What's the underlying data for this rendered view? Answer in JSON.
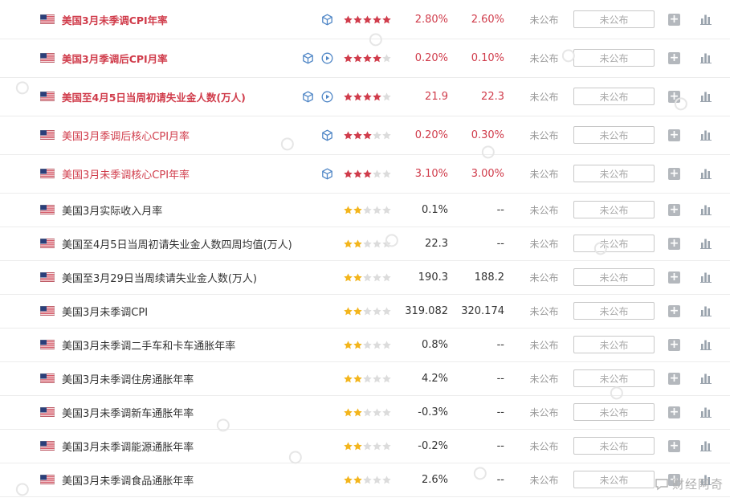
{
  "status_label": "未公布",
  "actual_placeholder": "未公布",
  "add_label": "+",
  "brand": "财经阿奇",
  "colors": {
    "important": "#d03c4b",
    "star_red": "#d03c4b",
    "star_gold": "#f3b51c",
    "star_empty": "#dcdcdc"
  },
  "rows": [
    {
      "name": "美国3月未季调CPI年率",
      "stars": 5,
      "star_color": "red",
      "previous": "2.80%",
      "forecast": "2.60%",
      "important": true,
      "bold": true,
      "icons": [
        "cube-icon"
      ]
    },
    {
      "name": "美国3月季调后CPI月率",
      "stars": 4,
      "star_color": "red",
      "previous": "0.20%",
      "forecast": "0.10%",
      "important": true,
      "bold": true,
      "icons": [
        "cube-icon",
        "play-icon"
      ]
    },
    {
      "name": "美国至4月5日当周初请失业金人数(万人)",
      "stars": 4,
      "star_color": "red",
      "previous": "21.9",
      "forecast": "22.3",
      "important": true,
      "bold": true,
      "icons": [
        "cube-icon",
        "play-icon"
      ]
    },
    {
      "name": "美国3月季调后核心CPI月率",
      "stars": 3,
      "star_color": "red",
      "previous": "0.20%",
      "forecast": "0.30%",
      "important": true,
      "bold": false,
      "icons": [
        "cube-icon"
      ]
    },
    {
      "name": "美国3月未季调核心CPI年率",
      "stars": 3,
      "star_color": "red",
      "previous": "3.10%",
      "forecast": "3.00%",
      "important": true,
      "bold": false,
      "icons": [
        "cube-icon"
      ]
    },
    {
      "name": "美国3月实际收入月率",
      "stars": 2,
      "star_color": "gold",
      "previous": "0.1%",
      "forecast": "--",
      "important": false,
      "bold": false,
      "icons": []
    },
    {
      "name": "美国至4月5日当周初请失业金人数四周均值(万人)",
      "stars": 2,
      "star_color": "gold",
      "previous": "22.3",
      "forecast": "--",
      "important": false,
      "bold": false,
      "icons": []
    },
    {
      "name": "美国至3月29日当周续请失业金人数(万人)",
      "stars": 2,
      "star_color": "gold",
      "previous": "190.3",
      "forecast": "188.2",
      "important": false,
      "bold": false,
      "icons": []
    },
    {
      "name": "美国3月未季调CPI",
      "stars": 2,
      "star_color": "gold",
      "previous": "319.082",
      "forecast": "320.174",
      "important": false,
      "bold": false,
      "icons": []
    },
    {
      "name": "美国3月未季调二手车和卡车通胀年率",
      "stars": 2,
      "star_color": "gold",
      "previous": "0.8%",
      "forecast": "--",
      "important": false,
      "bold": false,
      "icons": []
    },
    {
      "name": "美国3月未季调住房通胀年率",
      "stars": 2,
      "star_color": "gold",
      "previous": "4.2%",
      "forecast": "--",
      "important": false,
      "bold": false,
      "icons": []
    },
    {
      "name": "美国3月未季调新车通胀年率",
      "stars": 2,
      "star_color": "gold",
      "previous": "-0.3%",
      "forecast": "--",
      "important": false,
      "bold": false,
      "icons": []
    },
    {
      "name": "美国3月未季调能源通胀年率",
      "stars": 2,
      "star_color": "gold",
      "previous": "-0.2%",
      "forecast": "--",
      "important": false,
      "bold": false,
      "icons": []
    },
    {
      "name": "美国3月未季调食品通胀年率",
      "stars": 2,
      "star_color": "gold",
      "previous": "2.6%",
      "forecast": "--",
      "important": false,
      "bold": false,
      "icons": []
    }
  ]
}
